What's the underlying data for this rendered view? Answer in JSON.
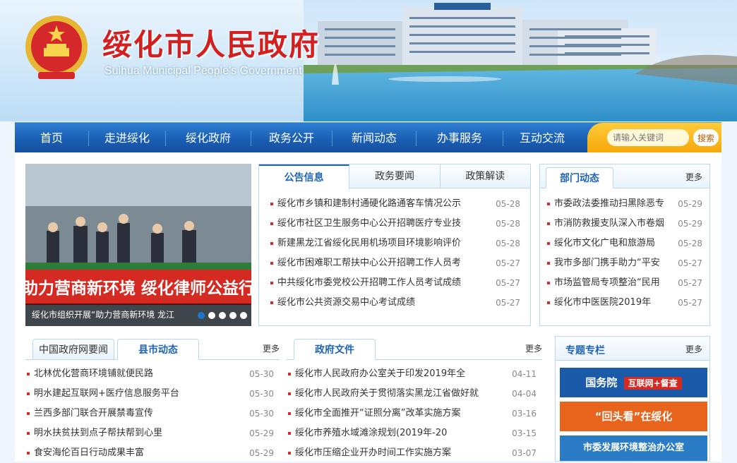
{
  "header": {
    "title": "绥化市人民政府",
    "subtitle": "Suihua Municipal People's Government"
  },
  "nav": {
    "items": [
      "首页",
      "走进绥化",
      "绥化政府",
      "政务公开",
      "新闻动态",
      "办事服务",
      "互动交流"
    ],
    "search_placeholder": "请输入关键词",
    "search_button": "搜索"
  },
  "slider": {
    "caption": "绥化市组织开展“助力营商新环境 龙江",
    "banner_text": "助力营商新环境  绥化律师公益行",
    "active_dot": 1,
    "dot_count": 5
  },
  "notices": {
    "tabs": [
      "公告信息",
      "政务要闻",
      "政策解读"
    ],
    "active_tab": 0,
    "items": [
      {
        "title": "绥化市乡镇和建制村通硬化路通客车情况公示",
        "date": "05-28"
      },
      {
        "title": "绥化市社区卫生服务中心公开招聘医疗专业技",
        "date": "05-28"
      },
      {
        "title": "新建黑龙江省绥化民用机场项目环境影响评价",
        "date": "05-28"
      },
      {
        "title": "绥化市困难职工帮扶中心公开招聘工作人员考",
        "date": "05-27"
      },
      {
        "title": "中共绥化市委党校公开招聘工作人员考试成绩",
        "date": "05-27"
      },
      {
        "title": "绥化市公共资源交易中心考试成绩",
        "date": "05-27"
      }
    ]
  },
  "dept": {
    "title": "部门动态",
    "more": "更多",
    "items": [
      {
        "title": "市委政法委推动扫黑除恶专",
        "date": "05-29"
      },
      {
        "title": "市消防救援支队深入市卷烟",
        "date": "05-29"
      },
      {
        "title": "绥化市文化广电和旅游局",
        "date": "05-28"
      },
      {
        "title": "我市多部门携手助力“平安",
        "date": "05-27"
      },
      {
        "title": "市场监管局专项整治“民用",
        "date": "05-27"
      },
      {
        "title": "绥化市中医医院2019年",
        "date": "05-27"
      }
    ]
  },
  "county": {
    "tabs": [
      "中国政府网要闻",
      "县市动态"
    ],
    "active_tab": 1,
    "more": "更多",
    "items": [
      {
        "title": "北林优化营商环境铺就便民路",
        "date": "05-30"
      },
      {
        "title": "明水建起互联网+医疗信息服务平台",
        "date": "05-30"
      },
      {
        "title": "兰西多部门联合开展禁毒宣传",
        "date": "05-30"
      },
      {
        "title": "明水扶贫扶到点子帮扶帮到心里",
        "date": "05-29"
      },
      {
        "title": "食安海伦百日行动成果丰富",
        "date": "05-29"
      }
    ]
  },
  "docs": {
    "title": "政府文件",
    "more": "更多",
    "items": [
      {
        "title": "绥化市人民政府办公室关于印发2019年全",
        "date": "04-11"
      },
      {
        "title": "绥化市人民政府关于贯彻落实黑龙江省做好就",
        "date": "04-04"
      },
      {
        "title": "绥化市全面推开“证照分离”改革实施方案",
        "date": "03-16"
      },
      {
        "title": "绥化市养殖水域滩涂规划(2019年-20",
        "date": "03-15"
      },
      {
        "title": "绥化市压缩企业开办时间工作实施方案",
        "date": "03-07"
      }
    ]
  },
  "special": {
    "title": "专题专栏",
    "more": "更多",
    "banners": [
      {
        "main": "国务院",
        "tag": "互联网+督查",
        "color": "#1a5aa8"
      },
      {
        "main": "“回头看”在绥化",
        "color": "#e8641c"
      },
      {
        "main": "市委发展环境整治办公室",
        "color": "#2a7cc7"
      }
    ]
  },
  "colors": {
    "nav_blue": "#1a5fb4",
    "title_red": "#d21f1f",
    "accent_orange": "#f6a609",
    "bullet_red": "#d32a2a"
  }
}
